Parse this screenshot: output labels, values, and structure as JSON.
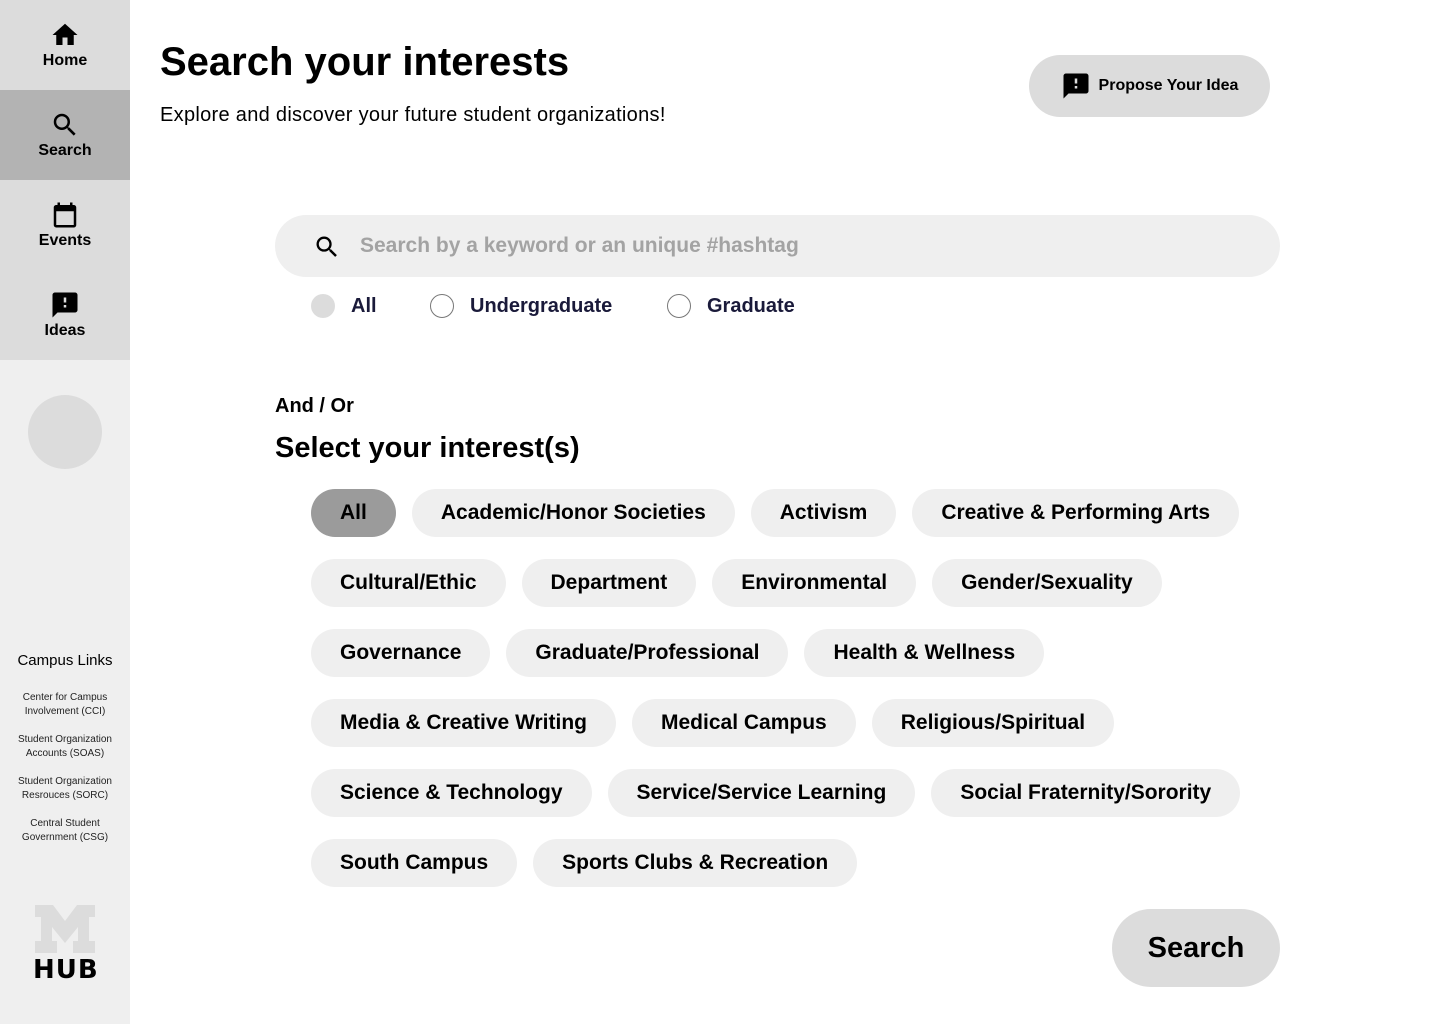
{
  "sidebar": {
    "nav": [
      {
        "label": "Home",
        "icon": "home-icon"
      },
      {
        "label": "Search",
        "icon": "search-icon"
      },
      {
        "label": "Events",
        "icon": "calendar-icon"
      },
      {
        "label": "Ideas",
        "icon": "feedback-icon"
      }
    ],
    "active": "Search",
    "campus_links_title": "Campus Links",
    "campus_links": [
      "Center for Campus Involvement (CCI)",
      "Student Organization Accounts (SOAS)",
      "Student Organization Resrouces (SORC)",
      "Central Student Government (CSG)"
    ],
    "logo_text": "HUB"
  },
  "header": {
    "title": "Search your interests",
    "subtitle": "Explore and discover your future student organizations!",
    "propose_label": "Propose Your Idea"
  },
  "search": {
    "placeholder": "Search by a keyword or an unique #hashtag",
    "value": ""
  },
  "level_filter": {
    "options": [
      "All",
      "Undergraduate",
      "Graduate"
    ],
    "selected": "All"
  },
  "interests": {
    "and_or_label": "And / Or",
    "title": "Select your interest(s)",
    "selected": "All",
    "chip_rows": [
      [
        "All",
        "Academic/Honor Societies",
        "Activism",
        "Creative & Performing Arts"
      ],
      [
        "Cultural/Ethic",
        "Department",
        "Environmental",
        "Gender/Sexuality"
      ],
      [
        "Governance",
        "Graduate/Professional",
        "Health & Wellness"
      ],
      [
        "Media & Creative Writing",
        "Medical Campus",
        "Religious/Spiritual"
      ],
      [
        "Science & Technology",
        "Service/Service Learning",
        "Social Fraternity/Sorority"
      ],
      [
        "South Campus",
        "Sports Clubs & Recreation"
      ]
    ]
  },
  "search_button_label": "Search"
}
